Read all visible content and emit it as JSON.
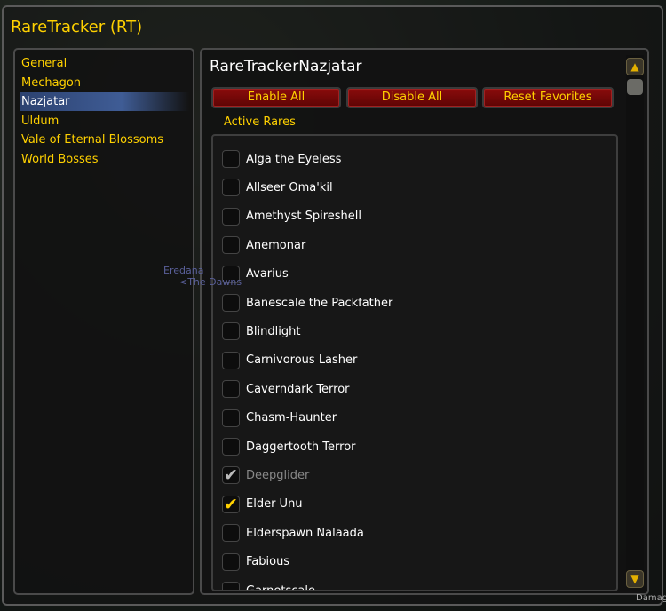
{
  "window": {
    "title": "RareTracker (RT)"
  },
  "background_text": {
    "name": "Eredana",
    "subtitle": "<The Dawns",
    "corner": "Damag"
  },
  "nav": {
    "items": [
      {
        "label": "General"
      },
      {
        "label": "Mechagon"
      },
      {
        "label": "Nazjatar",
        "selected": true
      },
      {
        "label": "Uldum"
      },
      {
        "label": "Vale of Eternal Blossoms"
      },
      {
        "label": "World Bosses"
      }
    ]
  },
  "panel": {
    "title": "RareTrackerNazjatar",
    "enable_all": "Enable All",
    "disable_all": "Disable All",
    "reset_favorites": "Reset Favorites",
    "section": "Active Rares"
  },
  "rares": [
    {
      "label": "Alga the Eyeless",
      "state": "unchecked"
    },
    {
      "label": "Allseer Oma'kil",
      "state": "unchecked"
    },
    {
      "label": "Amethyst Spireshell",
      "state": "unchecked"
    },
    {
      "label": "Anemonar",
      "state": "unchecked"
    },
    {
      "label": "Avarius",
      "state": "unchecked"
    },
    {
      "label": "Banescale the Packfather",
      "state": "unchecked"
    },
    {
      "label": "Blindlight",
      "state": "unchecked"
    },
    {
      "label": "Carnivorous Lasher",
      "state": "unchecked"
    },
    {
      "label": "Caverndark Terror",
      "state": "unchecked"
    },
    {
      "label": "Chasm-Haunter",
      "state": "unchecked"
    },
    {
      "label": "Daggertooth Terror",
      "state": "unchecked"
    },
    {
      "label": "Deepglider",
      "state": "checked-disabled"
    },
    {
      "label": "Elder Unu",
      "state": "checked"
    },
    {
      "label": "Elderspawn Nalaada",
      "state": "unchecked"
    },
    {
      "label": "Fabious",
      "state": "unchecked"
    },
    {
      "label": "Garnetscale",
      "state": "unchecked"
    }
  ],
  "colors": {
    "gold": "#ffd100",
    "button_red": "#7a0a0a",
    "selected": "#3f5c95"
  }
}
